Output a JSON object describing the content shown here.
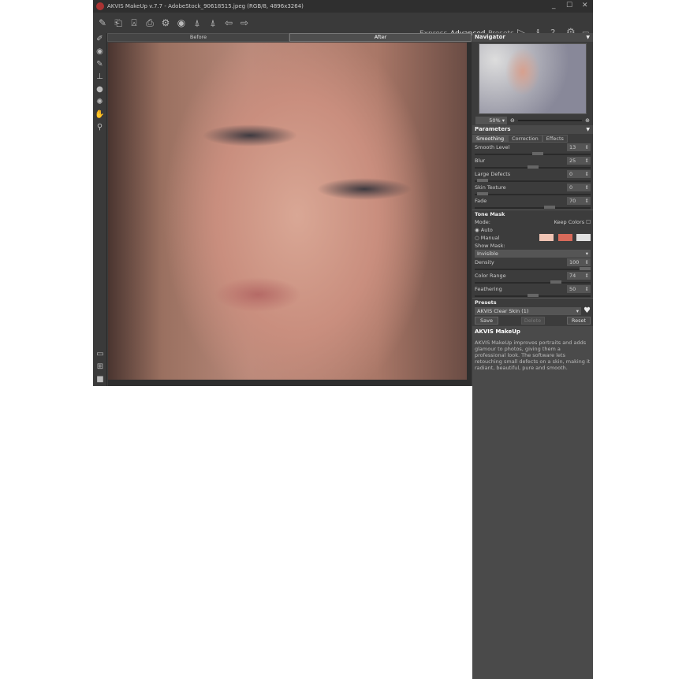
{
  "window": {
    "title": "AKVIS MakeUp v.7.7 - AdobeStock_90618515.jpeg (RGB/8, 4896x3264)",
    "minimize": "_",
    "maximize": "☐",
    "close": "✕"
  },
  "toolbar": {
    "modes": [
      "Express",
      "Advanced",
      "Presets"
    ],
    "active_mode": "Advanced"
  },
  "view_tabs": {
    "before": "Before",
    "after": "After"
  },
  "navigator": {
    "title": "Navigator",
    "zoom": "50%"
  },
  "parameters": {
    "title": "Parameters",
    "tabs": [
      "Smoothing",
      "Correction",
      "Effects"
    ],
    "sliders": [
      {
        "label": "Smooth Level",
        "value": "13",
        "fraction": 0.55
      },
      {
        "label": "Blur",
        "value": "25",
        "fraction": 0.5
      },
      {
        "label": "Large Defects",
        "value": "0",
        "fraction": 0.02
      },
      {
        "label": "Skin Texture",
        "value": "0",
        "fraction": 0.02
      },
      {
        "label": "Fade",
        "value": "70",
        "fraction": 0.66
      }
    ],
    "tone_mask": {
      "title": "Tone Mask",
      "mode_label": "Mode:",
      "keep_colors": "Keep Colors",
      "auto": "Auto",
      "manual": "Manual",
      "show_mask_label": "Show Mask:",
      "show_mask": "Invisible",
      "swatch_colors": [
        "#f0c4b4",
        "#d86a5a",
        "#e0e0e0"
      ]
    },
    "mask_sliders": [
      {
        "label": "Density",
        "value": "100",
        "fraction": 1.0
      },
      {
        "label": "Color Range",
        "value": "74",
        "fraction": 0.72
      },
      {
        "label": "Feathering",
        "value": "50",
        "fraction": 0.5
      }
    ]
  },
  "presets": {
    "title": "Presets",
    "selected": "AKVIS Clear Skin (1)",
    "save": "Save",
    "delete": "Delete",
    "reset": "Reset"
  },
  "info": {
    "title": "AKVIS MakeUp",
    "text": "AKVIS MakeUp improves portraits and adds glamour to photos, giving them a professional look. The software lets retouching small defects on a skin, making it radiant, beautiful, pure and smooth."
  }
}
